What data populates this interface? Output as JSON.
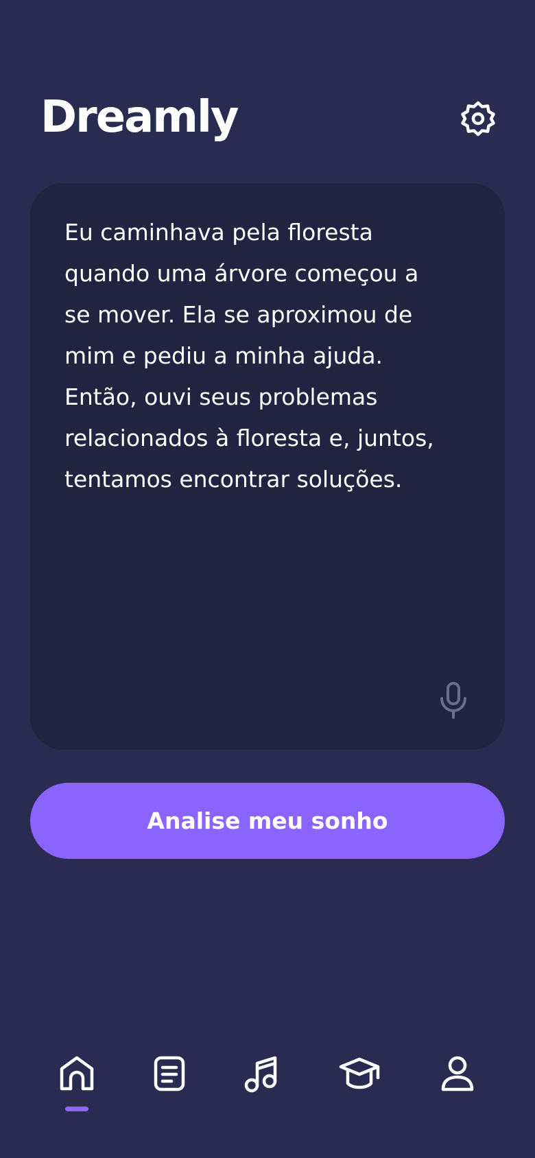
{
  "app": {
    "title": "Dreamly"
  },
  "header": {
    "settings_icon": "gear-icon"
  },
  "dream": {
    "text": "Eu caminhava pela floresta\nquando uma árvore começou a\nse mover. Ela se aproximou de\nmim e pediu a minha ajuda.\nEntão, ouvi seus problemas\nrelacionados à floresta e, juntos,\ntentamos encontrar soluções.",
    "mic_icon": "microphone-icon"
  },
  "actions": {
    "analyze_label": "Analise meu sonho"
  },
  "nav": {
    "active_index": 0,
    "items": [
      {
        "icon": "home-icon"
      },
      {
        "icon": "document-icon"
      },
      {
        "icon": "music-note-icon"
      },
      {
        "icon": "graduation-cap-icon"
      },
      {
        "icon": "user-icon"
      }
    ]
  },
  "colors": {
    "background": "#292c50",
    "card": "#212341",
    "accent": "#8b63fd",
    "text": "#ffffff",
    "mic_muted": "#6b6d8a"
  }
}
